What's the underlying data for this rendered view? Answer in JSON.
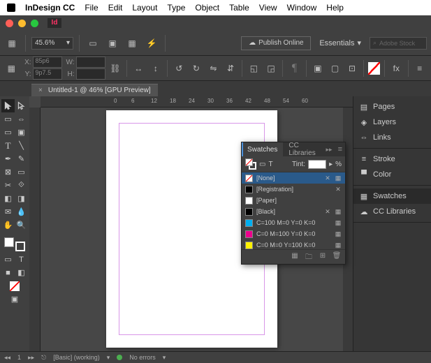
{
  "menubar": {
    "app": "InDesign CC",
    "items": [
      "File",
      "Edit",
      "Layout",
      "Type",
      "Object",
      "Table",
      "View",
      "Window",
      "Help"
    ]
  },
  "appbar": {
    "zoom": "45.6%",
    "publish": "Publish Online",
    "workspace": "Essentials",
    "search_placeholder": "Adobe Stock"
  },
  "optbar": {
    "x": "85p6",
    "y": "9p7.5",
    "w": "",
    "h": ""
  },
  "tab": {
    "title": "Untitled-1 @ 46% [GPU Preview]"
  },
  "ruler_ticks": [
    "0",
    "6",
    "12",
    "18",
    "24",
    "30",
    "36",
    "42",
    "48",
    "54",
    "60"
  ],
  "dock": {
    "pages": "Pages",
    "layers": "Layers",
    "links": "Links",
    "stroke": "Stroke",
    "color": "Color",
    "swatches": "Swatches",
    "cclib": "CC Libraries"
  },
  "swatches": {
    "tab1": "Swatches",
    "tab2": "CC Libraries",
    "tint_label": "Tint:",
    "tint_unit": "%",
    "items": [
      {
        "name": "[None]",
        "color": "none",
        "sel": true,
        "lock": true,
        "spot": true
      },
      {
        "name": "[Registration]",
        "color": "#000",
        "lock": true
      },
      {
        "name": "[Paper]",
        "color": "#fff"
      },
      {
        "name": "[Black]",
        "color": "#000",
        "lock": true,
        "spot": true
      },
      {
        "name": "C=100 M=0 Y=0 K=0",
        "color": "#00aeef",
        "spot": true
      },
      {
        "name": "C=0 M=100 Y=0 K=0",
        "color": "#ec008c",
        "spot": true
      },
      {
        "name": "C=0 M=0 Y=100 K=0",
        "color": "#fff200",
        "spot": true
      }
    ]
  },
  "status": {
    "preset": "[Basic] (working)",
    "errors": "No errors"
  }
}
